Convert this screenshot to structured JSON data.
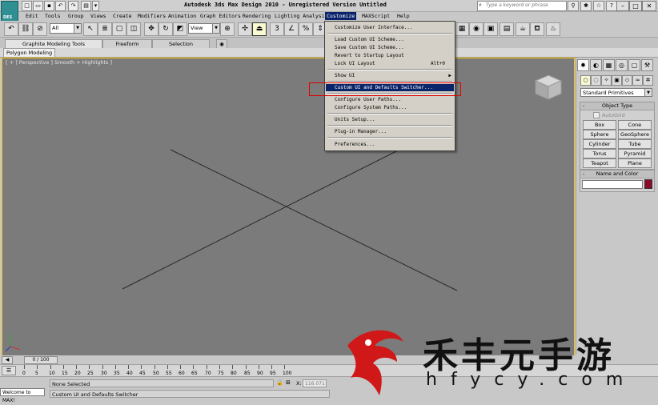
{
  "app": {
    "title": "Autodesk 3ds Max Design 2010  -  Unregistered Version  Untitled",
    "logo_text": "DES",
    "search_placeholder": "Type a keyword or phrase"
  },
  "menubar": {
    "items": [
      "Edit",
      "Tools",
      "Group",
      "Views",
      "Create",
      "Modifiers",
      "Animation",
      "Graph Editors",
      "Rendering",
      "Lighting Analysis",
      "Customize",
      "MAXScript",
      "Help"
    ],
    "active": "Customize"
  },
  "toolbar": {
    "selection_filter": "All",
    "ref_coord": "View"
  },
  "ribbon": {
    "tabs": [
      "Graphite Modeling Tools",
      "Freeform",
      "Selection"
    ],
    "panel_tab": "Polygon Modeling"
  },
  "viewport": {
    "label": "[ + ] Perspective ] Smooth + Highlights ]",
    "accent_color": "#f4c000"
  },
  "customize_menu": {
    "items": [
      {
        "label": "Customize User Interface...",
        "shortcut": "",
        "submenu": false
      },
      {
        "label": "Load Custom UI Scheme...",
        "shortcut": "",
        "submenu": false
      },
      {
        "label": "Save Custom UI Scheme...",
        "shortcut": "",
        "submenu": false
      },
      {
        "label": "Revert to Startup Layout",
        "shortcut": "",
        "submenu": false
      },
      {
        "label": "Lock UI Layout",
        "shortcut": "Alt+0",
        "submenu": false
      },
      {
        "label": "Show UI",
        "shortcut": "",
        "submenu": true
      },
      {
        "label": "Custom UI and Defaults Switcher...",
        "shortcut": "",
        "submenu": false,
        "highlighted": true
      },
      {
        "label": "Configure User Paths...",
        "shortcut": "",
        "submenu": false
      },
      {
        "label": "Configure System Paths...",
        "shortcut": "",
        "submenu": false
      },
      {
        "label": "Units Setup...",
        "shortcut": "",
        "submenu": false
      },
      {
        "label": "Plug-in Manager...",
        "shortcut": "",
        "submenu": false
      },
      {
        "label": "Preferences...",
        "shortcut": "",
        "submenu": false
      }
    ],
    "highlight_color": "#0a246a",
    "annotation_color": "#e00000"
  },
  "command_panel": {
    "category": "Standard Primitives",
    "object_type_title": "Object Type",
    "autogrid_label": "AutoGrid",
    "primitives": [
      "Box",
      "Cone",
      "Sphere",
      "GeoSphere",
      "Cylinder",
      "Tube",
      "Torus",
      "Pyramid",
      "Teapot",
      "Plane"
    ],
    "name_color_title": "Name and Color",
    "object_color": "#8b0a2a"
  },
  "timeline": {
    "slider_text": "0 / 100",
    "ticks": [
      "0",
      "5",
      "10",
      "15",
      "20",
      "25",
      "30",
      "35",
      "40",
      "45",
      "50",
      "55",
      "60",
      "65",
      "70",
      "75",
      "80",
      "85",
      "90",
      "95",
      "100"
    ]
  },
  "status": {
    "welcome": "Welcome to MAX!",
    "selection": "None Selected",
    "prompt": "Custom UI and Defaults Switcher",
    "x_label": "X:",
    "x_value": "116.071"
  },
  "watermark": {
    "text": "禾丰元手游",
    "sub": "hfycy.com",
    "logo_color": "#d01818"
  }
}
